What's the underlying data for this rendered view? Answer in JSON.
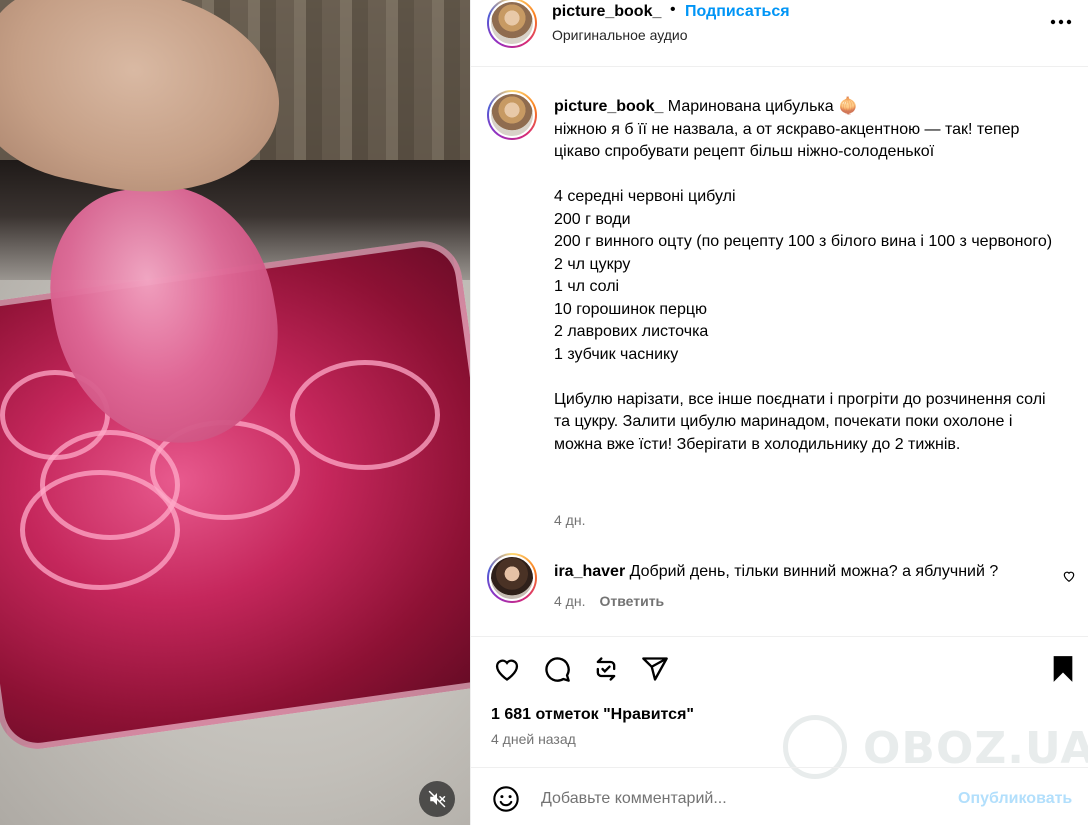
{
  "header": {
    "username": "picture_book_",
    "separator": "•",
    "follow_label": "Подписаться",
    "audio_label": "Оригинальное аудио"
  },
  "caption": {
    "username": "picture_book_",
    "text": " Маринована цибулька 🧅\nніжною я б її не назвала, а от яскраво-акцентною — так! тепер цікаво спробувати рецепт більш ніжно-солоденької\n\n4 середні червоні цибулі\n200 г води\n200 г винного оцту (по рецепту 100 з білого вина і 100 з червоного)\n2 чл цукру\n1 чл солі\n10 горошинок перцю\n2 лаврових листочка\n1 зубчик часнику\n\nЦибулю нарізати, все інше поєднати і прогріти до розчинення солі та цукру. Залити цибулю маринадом, почекати поки охолоне і можна вже їсти! Зберігати в холодильнику до 2 тижнів.",
    "time": "4 дн."
  },
  "comment": {
    "username": "ira_haver",
    "text": "Добрий день, тільки винний можна? а яблучний ?",
    "time": "4 дн.",
    "reply_label": "Ответить"
  },
  "footer": {
    "likes": "1 681 отметок \"Нравится\"",
    "posted_ago": "4 дней назад",
    "comment_placeholder": "Добавьте комментарий...",
    "publish_label": "Опубликовать"
  },
  "watermark": {
    "text": "OBOZ.UA"
  },
  "icons": {
    "more": "more-horizontal-icon",
    "like": "heart-icon",
    "comment": "comment-icon",
    "repost": "repost-icon",
    "share": "share-icon",
    "save": "bookmark-icon",
    "emoji": "emoji-icon",
    "mute": "muted-speaker-icon"
  },
  "colors": {
    "link_blue": "#0095f6",
    "publish_disabled": "#b2dffc",
    "secondary_text": "#737373"
  }
}
